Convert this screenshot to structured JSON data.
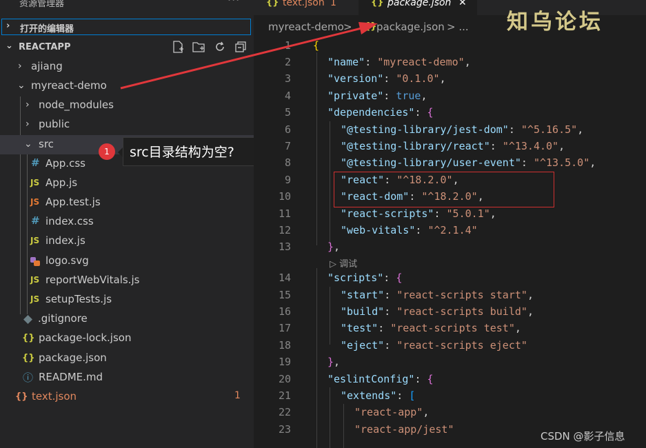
{
  "sidebar": {
    "title": "资源管理器",
    "more": "···",
    "open_editors": "打开的编辑器",
    "root": "REACTAPP",
    "items": [
      {
        "label": "ajiang",
        "icon": "chevron-right-icon"
      },
      {
        "label": "myreact-demo",
        "icon": "chevron-down-icon"
      },
      {
        "label": "node_modules",
        "icon": "chevron-right-icon"
      },
      {
        "label": "public",
        "icon": "chevron-right-icon"
      },
      {
        "label": "src",
        "icon": "chevron-down-icon"
      },
      {
        "label": "App.css",
        "icon": "#"
      },
      {
        "label": "App.js",
        "icon": "JS"
      },
      {
        "label": "App.test.js",
        "icon": "JS"
      },
      {
        "label": "index.css",
        "icon": "#"
      },
      {
        "label": "index.js",
        "icon": "JS"
      },
      {
        "label": "logo.svg",
        "icon": "svg-file-icon"
      },
      {
        "label": "reportWebVitals.js",
        "icon": "JS"
      },
      {
        "label": "setupTests.js",
        "icon": "JS"
      },
      {
        "label": ".gitignore",
        "icon": "gitignore-icon"
      },
      {
        "label": "package-lock.json",
        "icon": "{}"
      },
      {
        "label": "package.json",
        "icon": "{}"
      },
      {
        "label": "README.md",
        "icon": "ⓘ"
      },
      {
        "label": "text.json",
        "icon": "{}",
        "badge": "1"
      }
    ]
  },
  "tooltip": {
    "number": "1",
    "text": "src目录结构为空?"
  },
  "tabs": [
    {
      "icon": "{}",
      "label": "text.json",
      "badge": "1"
    },
    {
      "icon": "{}",
      "label": "package.json",
      "close": "✕"
    }
  ],
  "breadcrumb": {
    "folder": "myreact-demo",
    "sep": ">",
    "file": "package.json",
    "more": "> ..."
  },
  "code": {
    "line_numbers": [
      "1",
      "2",
      "3",
      "4",
      "5",
      "6",
      "7",
      "8",
      "9",
      "10",
      "11",
      "12",
      "13",
      "14",
      "15",
      "16",
      "17",
      "18",
      "19",
      "20",
      "21",
      "22",
      "23"
    ],
    "codelens": "调试",
    "lines": [
      "{",
      "\"name\": \"myreact-demo\",",
      "\"version\": \"0.1.0\",",
      "\"private\": true,",
      "\"dependencies\": {",
      "\"@testing-library/jest-dom\": \"^5.16.5\",",
      "\"@testing-library/react\": \"^13.4.0\",",
      "\"@testing-library/user-event\": \"^13.5.0\",",
      "\"react\": \"^18.2.0\",",
      "\"react-dom\": \"^18.2.0\",",
      "\"react-scripts\": \"5.0.1\",",
      "\"web-vitals\": \"^2.1.4\"",
      "},",
      "\"scripts\": {",
      "\"start\": \"react-scripts start\",",
      "\"build\": \"react-scripts build\",",
      "\"test\": \"react-scripts test\",",
      "\"eject\": \"react-scripts eject\"",
      "},",
      "\"eslintConfig\": {",
      "\"extends\": [",
      "\"react-app\",",
      "\"react-app/jest\""
    ]
  },
  "watermark": "知乌论坛",
  "footer_credit": "CSDN @影子信息",
  "colors": {
    "accent": "#007fd4",
    "error": "#e2885e",
    "annotation": "#e0373b"
  }
}
